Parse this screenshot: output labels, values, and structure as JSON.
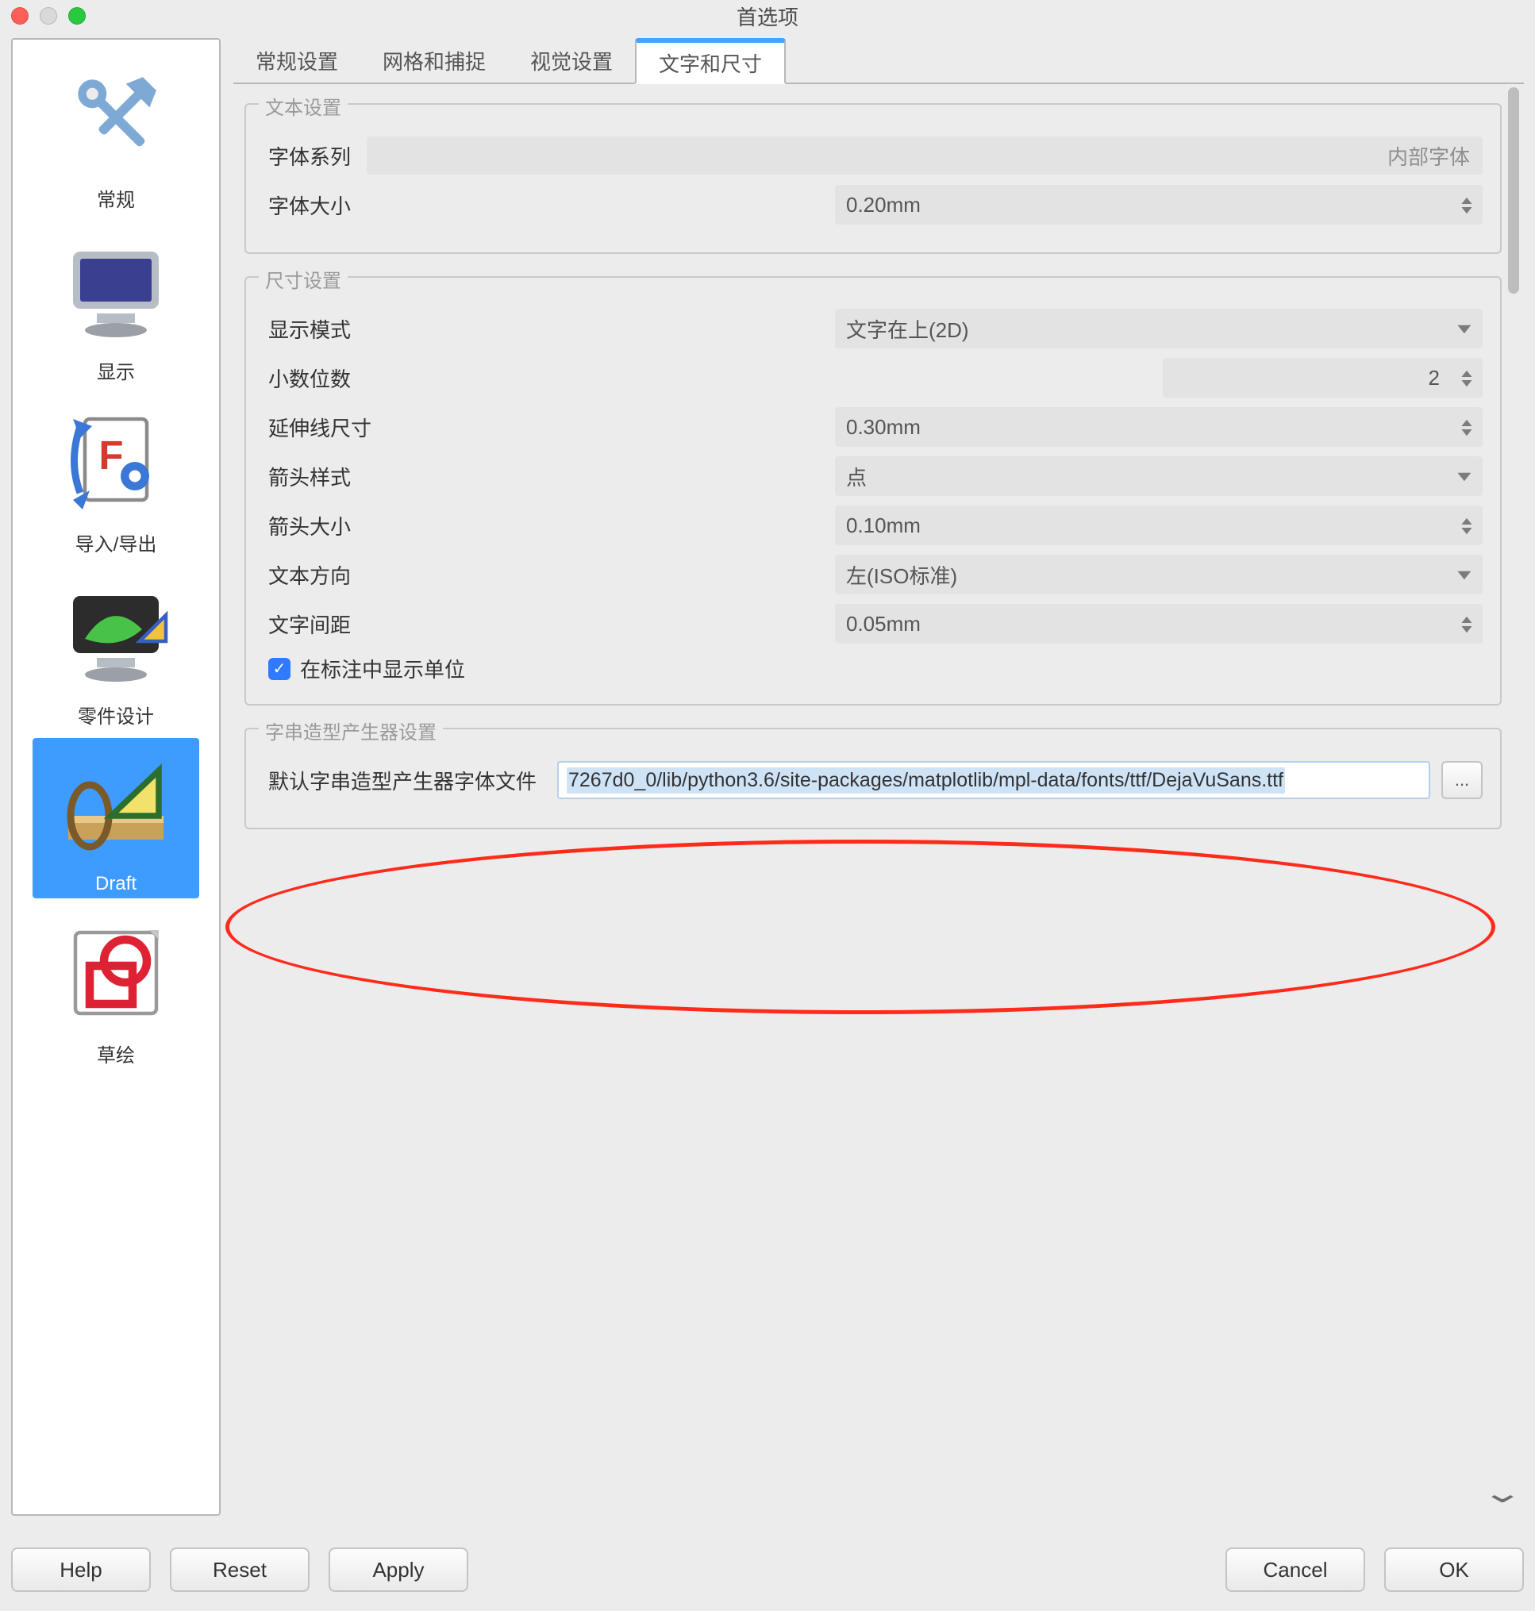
{
  "window": {
    "title": "首选项"
  },
  "sidebar": {
    "items": [
      {
        "label": "常规"
      },
      {
        "label": "显示"
      },
      {
        "label": "导入/导出"
      },
      {
        "label": "零件设计"
      },
      {
        "label": "Draft"
      },
      {
        "label": "草绘"
      }
    ],
    "selected_index": 4
  },
  "tabs": {
    "items": [
      {
        "label": "常规设置"
      },
      {
        "label": "网格和捕捉"
      },
      {
        "label": "视觉设置"
      },
      {
        "label": "文字和尺寸"
      }
    ],
    "active_index": 3
  },
  "groups": {
    "text": {
      "legend": "文本设置",
      "font_family_label": "字体系列",
      "font_family_value": "内部字体",
      "font_size_label": "字体大小",
      "font_size_value": "0.20mm"
    },
    "dim": {
      "legend": "尺寸设置",
      "display_mode_label": "显示模式",
      "display_mode_value": "文字在上(2D)",
      "decimals_label": "小数位数",
      "decimals_value": "2",
      "ext_line_label": "延伸线尺寸",
      "ext_line_value": "0.30mm",
      "arrow_style_label": "箭头样式",
      "arrow_style_value": "点",
      "arrow_size_label": "箭头大小",
      "arrow_size_value": "0.10mm",
      "text_dir_label": "文本方向",
      "text_dir_value": "左(ISO标准)",
      "text_spacing_label": "文字间距",
      "text_spacing_value": "0.05mm",
      "show_unit_label": "在标注中显示单位",
      "show_unit_checked": true
    },
    "shape": {
      "legend": "字串造型产生器设置",
      "font_file_label": "默认字串造型产生器字体文件",
      "font_file_value": "7267d0_0/lib/python3.6/site-packages/matplotlib/mpl-data/fonts/ttf/DejaVuSans.ttf",
      "browse_label": "..."
    }
  },
  "footer": {
    "help": "Help",
    "reset": "Reset",
    "apply": "Apply",
    "cancel": "Cancel",
    "ok": "OK"
  }
}
